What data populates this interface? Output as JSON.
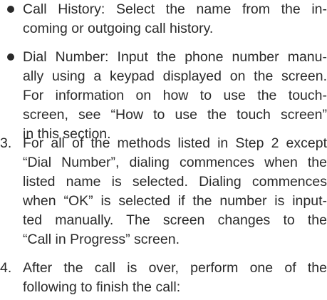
{
  "bullets": [
    {
      "lines": [
        "Call History: Select the name from the in-",
        "coming or outgoing call history."
      ]
    },
    {
      "lines": [
        "Dial Number: Input the phone number manu-",
        "ally using a keypad displayed on the screen.",
        "For information on how to use the touch-",
        "screen, see “How to use the touch screen”",
        "in this section."
      ]
    }
  ],
  "steps": [
    {
      "number": "3.",
      "lines": [
        "For all of the methods listed in Step 2 except",
        "“Dial Number”, dialing commences when the",
        "listed name is selected. Dialing commences",
        "when “OK” is selected if the number is input-",
        "ted manually. The screen changes to the",
        "“Call in Progress” screen."
      ]
    },
    {
      "number": "4.",
      "lines": [
        "After the call is over, perform one of the",
        "following to finish the call:"
      ]
    }
  ]
}
